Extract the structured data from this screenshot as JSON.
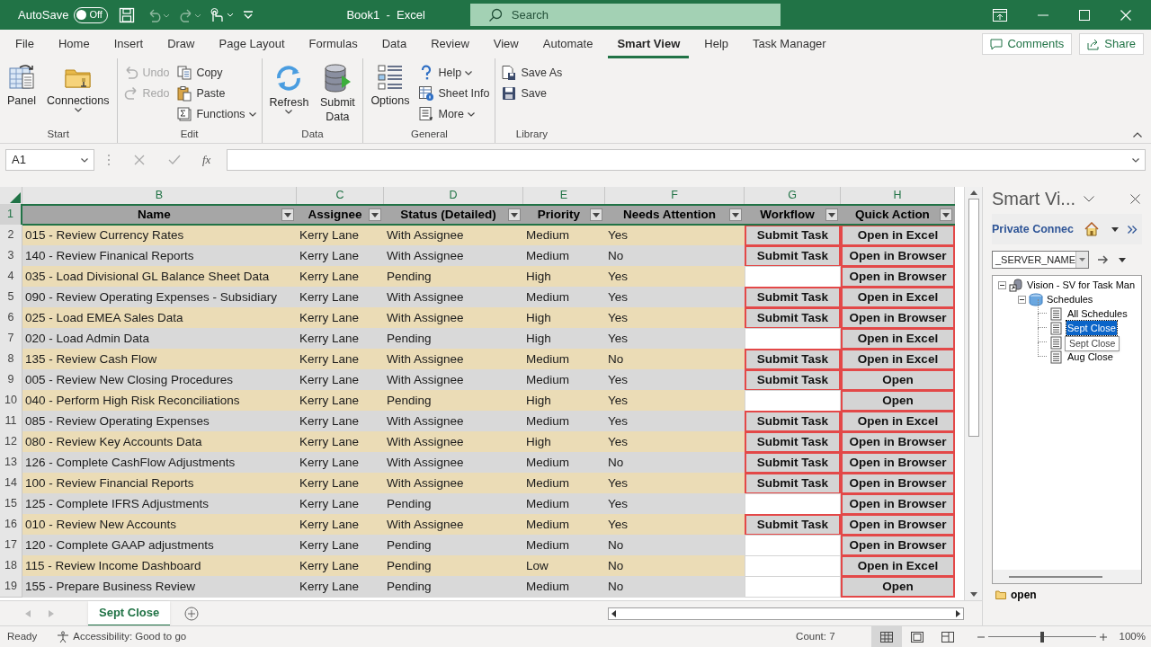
{
  "title_bar": {
    "autosave_label": "AutoSave",
    "autosave_toggle": {
      "label": "Off",
      "on": false
    },
    "title": "Book1  -  Excel",
    "search": {
      "placeholder": "Search"
    }
  },
  "ribbon_tabs": [
    {
      "label": "File",
      "selected": false
    },
    {
      "label": "Home",
      "selected": false
    },
    {
      "label": "Insert",
      "selected": false
    },
    {
      "label": "Draw",
      "selected": false
    },
    {
      "label": "Page Layout",
      "selected": false
    },
    {
      "label": "Formulas",
      "selected": false
    },
    {
      "label": "Data",
      "selected": false
    },
    {
      "label": "Review",
      "selected": false
    },
    {
      "label": "View",
      "selected": false
    },
    {
      "label": "Automate",
      "selected": false
    },
    {
      "label": "Smart View",
      "selected": true
    },
    {
      "label": "Help",
      "selected": false
    },
    {
      "label": "Task Manager",
      "selected": false
    }
  ],
  "comments_button": "Comments",
  "share_button": "Share",
  "ribbon_groups": [
    {
      "label": "Start",
      "columns": [
        {
          "kind": "large",
          "items": [
            {
              "label": "Panel",
              "disabled": false,
              "dropdown": false
            }
          ]
        },
        {
          "kind": "large",
          "items": [
            {
              "label": "Connections",
              "disabled": false,
              "dropdown": true
            }
          ]
        }
      ]
    },
    {
      "label": "Edit",
      "columns": [
        {
          "kind": "small",
          "items": [
            {
              "label": "Undo",
              "disabled": true,
              "dropdown": false
            },
            {
              "label": "Redo",
              "disabled": true,
              "dropdown": false
            }
          ]
        },
        {
          "kind": "small",
          "items": [
            {
              "label": "Copy",
              "disabled": false,
              "dropdown": false
            },
            {
              "label": "Paste",
              "disabled": false,
              "dropdown": false
            },
            {
              "label": "Functions",
              "disabled": false,
              "dropdown": true
            }
          ]
        }
      ]
    },
    {
      "label": "Data",
      "columns": [
        {
          "kind": "large",
          "items": [
            {
              "label": "Refresh",
              "disabled": false,
              "dropdown": true
            }
          ]
        },
        {
          "kind": "large",
          "items": [
            {
              "label": "Submit Data",
              "disabled": false,
              "dropdown": false
            }
          ]
        }
      ]
    },
    {
      "label": "General",
      "columns": [
        {
          "kind": "large",
          "items": [
            {
              "label": "Options",
              "disabled": false,
              "dropdown": false
            }
          ]
        },
        {
          "kind": "small",
          "items": [
            {
              "label": "Help",
              "disabled": false,
              "dropdown": true
            },
            {
              "label": "Sheet Info",
              "disabled": false,
              "dropdown": false
            },
            {
              "label": "More",
              "disabled": false,
              "dropdown": true
            }
          ]
        }
      ]
    },
    {
      "label": "Library",
      "columns": [
        {
          "kind": "small",
          "items": [
            {
              "label": "Save As",
              "disabled": false,
              "dropdown": false
            },
            {
              "label": "Save",
              "disabled": false,
              "dropdown": false
            }
          ]
        }
      ]
    }
  ],
  "formula_bar": {
    "name_box": "A1",
    "function_label": "fx"
  },
  "sheet": {
    "column_letters": [
      "B",
      "C",
      "D",
      "E",
      "F",
      "G",
      "H"
    ],
    "header": {
      "row_number": "1",
      "cells": [
        "Name",
        "Assignee",
        "Status (Detailed)",
        "Priority",
        "Needs Attention",
        "Workflow",
        "Quick Action"
      ]
    },
    "rows": [
      {
        "row_number": "2",
        "name": "015 - Review Currency Rates",
        "assignee": "Kerry Lane",
        "status": "With Assignee",
        "priority": "Medium",
        "needs_attention": "Yes",
        "workflow": "Submit Task",
        "quick_action": "Open in Excel"
      },
      {
        "row_number": "3",
        "name": "140 - Review Finanical Reports",
        "assignee": "Kerry Lane",
        "status": "With Assignee",
        "priority": "Medium",
        "needs_attention": "No",
        "workflow": "Submit Task",
        "quick_action": "Open in Browser"
      },
      {
        "row_number": "4",
        "name": "035 - Load Divisional GL Balance Sheet Data",
        "assignee": "Kerry Lane",
        "status": "Pending",
        "priority": "High",
        "needs_attention": "Yes",
        "quick_action": "Open in Browser"
      },
      {
        "row_number": "5",
        "name": "090 - Review Operating Expenses - Subsidiary",
        "assignee": "Kerry Lane",
        "status": "With Assignee",
        "priority": "Medium",
        "needs_attention": "Yes",
        "workflow": "Submit Task",
        "quick_action": "Open in Excel"
      },
      {
        "row_number": "6",
        "name": "025 - Load EMEA Sales Data",
        "assignee": "Kerry Lane",
        "status": "With Assignee",
        "priority": "High",
        "needs_attention": "Yes",
        "workflow": "Submit Task",
        "quick_action": "Open in Browser"
      },
      {
        "row_number": "7",
        "name": "020 - Load Admin Data",
        "assignee": "Kerry Lane",
        "status": "Pending",
        "priority": "High",
        "needs_attention": "Yes",
        "quick_action": "Open in Excel"
      },
      {
        "row_number": "8",
        "name": "135 - Review Cash Flow",
        "assignee": "Kerry Lane",
        "status": "With Assignee",
        "priority": "Medium",
        "needs_attention": "No",
        "workflow": "Submit Task",
        "quick_action": "Open in Excel"
      },
      {
        "row_number": "9",
        "name": "005 - Review New Closing Procedures",
        "assignee": "Kerry Lane",
        "status": "With Assignee",
        "priority": "Medium",
        "needs_attention": "Yes",
        "workflow": "Submit Task",
        "quick_action": "Open"
      },
      {
        "row_number": "10",
        "name": "040 - Perform High Risk Reconciliations",
        "assignee": "Kerry Lane",
        "status": "Pending",
        "priority": "High",
        "needs_attention": "Yes",
        "quick_action": "Open"
      },
      {
        "row_number": "11",
        "name": "085 - Review Operating Expenses",
        "assignee": "Kerry Lane",
        "status": "With Assignee",
        "priority": "Medium",
        "needs_attention": "Yes",
        "workflow": "Submit Task",
        "quick_action": "Open in Excel"
      },
      {
        "row_number": "12",
        "name": "080 - Review Key Accounts Data",
        "assignee": "Kerry Lane",
        "status": "With Assignee",
        "priority": "High",
        "needs_attention": "Yes",
        "workflow": "Submit Task",
        "quick_action": "Open in Browser"
      },
      {
        "row_number": "13",
        "name": "126 - Complete CashFlow Adjustments",
        "assignee": "Kerry Lane",
        "status": "With Assignee",
        "priority": "Medium",
        "needs_attention": "No",
        "workflow": "Submit Task",
        "quick_action": "Open in Browser"
      },
      {
        "row_number": "14",
        "name": "100 - Review Financial Reports",
        "assignee": "Kerry Lane",
        "status": "With Assignee",
        "priority": "Medium",
        "needs_attention": "Yes",
        "workflow": "Submit Task",
        "quick_action": "Open in Browser"
      },
      {
        "row_number": "15",
        "name": "125 - Complete IFRS Adjustments",
        "assignee": "Kerry Lane",
        "status": "Pending",
        "priority": "Medium",
        "needs_attention": "Yes",
        "quick_action": "Open in Browser"
      },
      {
        "row_number": "16",
        "name": "010 - Review New Accounts",
        "assignee": "Kerry Lane",
        "status": "With Assignee",
        "priority": "Medium",
        "needs_attention": "Yes",
        "workflow": "Submit Task",
        "quick_action": "Open in Browser"
      },
      {
        "row_number": "17",
        "name": "120 - Complete GAAP adjustments",
        "assignee": "Kerry Lane",
        "status": "Pending",
        "priority": "Medium",
        "needs_attention": "No",
        "quick_action": "Open in Browser"
      },
      {
        "row_number": "18",
        "name": "115 - Review Income Dashboard",
        "assignee": "Kerry Lane",
        "status": "Pending",
        "priority": "Low",
        "needs_attention": "No",
        "quick_action": "Open in Excel"
      },
      {
        "row_number": "19",
        "name": "155 - Prepare Business Review",
        "assignee": "Kerry Lane",
        "status": "Pending",
        "priority": "Medium",
        "needs_attention": "No",
        "quick_action": "Open"
      }
    ]
  },
  "sheet_tabs": [
    {
      "label": "Sept Close",
      "selected": true
    }
  ],
  "smart_view": {
    "title": "Smart Vi...",
    "connection": "Private Connec",
    "server_field": "_SERVER_NAME",
    "tree": [
      {
        "label": "Vision - SV for Task Man",
        "expanded": true,
        "children": [
          {
            "label": "Schedules",
            "expanded": true,
            "children": [
              {
                "label": "All Schedules",
                "selected": false
              },
              {
                "label": "Sept Close",
                "selected": true
              },
              {
                "selected": false
              },
              {
                "label": "Aug Close",
                "selected": false
              }
            ]
          }
        ]
      }
    ],
    "tooltip": "Sept Close",
    "footer": "open"
  },
  "status_bar": {
    "ready": "Ready",
    "accessibility": "Accessibility: Good to go",
    "count": "Count: 7",
    "views": [
      {
        "kind": "normal",
        "selected": true
      },
      {
        "kind": "page_layout",
        "selected": false
      },
      {
        "kind": "page_break",
        "selected": false
      }
    ],
    "zoom": {
      "level": 0.5
    },
    "zoom_label": "100%"
  }
}
